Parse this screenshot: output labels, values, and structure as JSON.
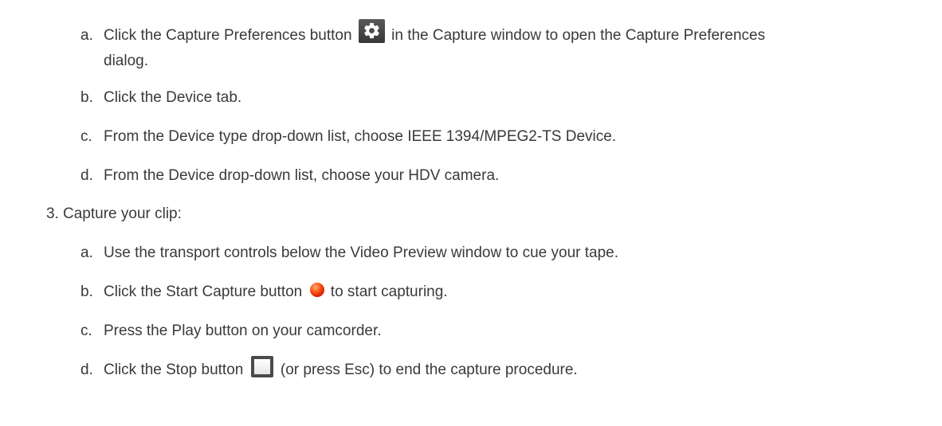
{
  "steps": {
    "prefs_a": {
      "marker": "a.",
      "text_before": "Click the Capture Preferences button",
      "text_after": "in the Capture window to open the Capture Preferences",
      "text_cont": "dialog.",
      "icon": "gear-icon"
    },
    "prefs_b": {
      "marker": "b.",
      "text": "Click the Device tab."
    },
    "prefs_c": {
      "marker": "c.",
      "text": "From the Device type drop-down list, choose IEEE 1394/MPEG2-TS Device."
    },
    "prefs_d": {
      "marker": "d.",
      "text": "From the Device drop-down list, choose your HDV camera."
    },
    "step3": {
      "marker": "3.",
      "text": "Capture your clip:"
    },
    "cap_a": {
      "marker": "a.",
      "text": "Use the transport controls below the Video Preview window to cue your tape."
    },
    "cap_b": {
      "marker": "b.",
      "text_before": "Click the Start Capture button",
      "text_after": "to start capturing.",
      "icon": "record-icon"
    },
    "cap_c": {
      "marker": "c.",
      "text": "Press the Play button on your camcorder."
    },
    "cap_d": {
      "marker": "d.",
      "text_before": "Click the Stop button",
      "text_after": "(or press Esc) to end the capture procedure.",
      "icon": "stop-icon"
    }
  }
}
